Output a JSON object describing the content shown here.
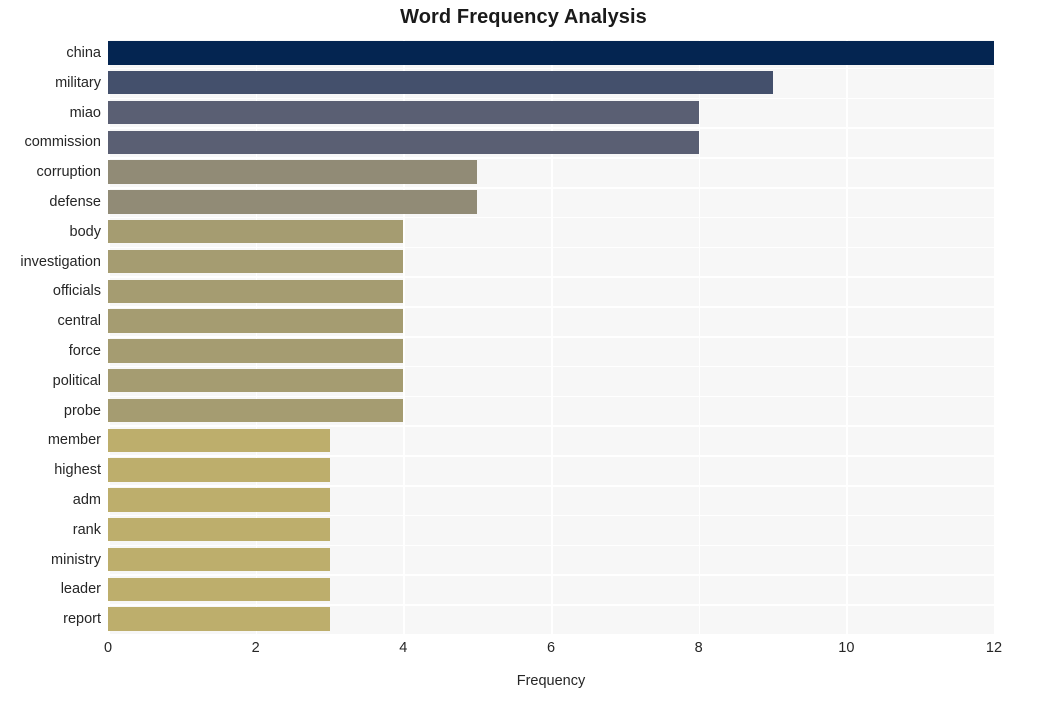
{
  "chart_data": {
    "type": "bar",
    "orientation": "horizontal",
    "title": "Word Frequency Analysis",
    "xlabel": "Frequency",
    "ylabel": "",
    "xlim": [
      0,
      12
    ],
    "xticks": [
      0,
      2,
      4,
      6,
      8,
      10,
      12
    ],
    "xtick_labels": [
      "0",
      "2",
      "4",
      "6",
      "8",
      "10",
      "12"
    ],
    "grid": true,
    "legend": false,
    "categories": [
      "china",
      "military",
      "miao",
      "commission",
      "corruption",
      "defense",
      "body",
      "investigation",
      "officials",
      "central",
      "force",
      "political",
      "probe",
      "member",
      "highest",
      "adm",
      "rank",
      "ministry",
      "leader",
      "report"
    ],
    "values": [
      12,
      9,
      8,
      8,
      5,
      5,
      4,
      4,
      4,
      4,
      4,
      4,
      4,
      3,
      3,
      3,
      3,
      3,
      3,
      3
    ],
    "bar_colors": [
      "#042551",
      "#44506c",
      "#5a5f73",
      "#5a5f73",
      "#918b76",
      "#918b76",
      "#a59c71",
      "#a59c71",
      "#a59c71",
      "#a59c71",
      "#a59c71",
      "#a59c71",
      "#a59c71",
      "#bdae6c",
      "#bdae6c",
      "#bdae6c",
      "#bdae6c",
      "#bdae6c",
      "#bdae6c",
      "#bdae6c"
    ],
    "plot_background": "#f7f7f7",
    "gridline_color": "#ffffff",
    "figure_background": "#ffffff",
    "text_color": "#262626",
    "title_color": "#1a1a1a"
  }
}
